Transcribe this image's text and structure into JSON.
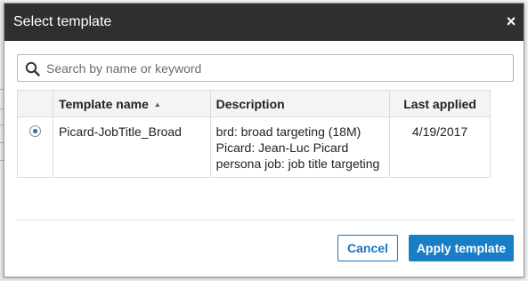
{
  "dialog": {
    "title": "Select template",
    "close_glyph": "×"
  },
  "search": {
    "placeholder": "Search by name or keyword",
    "value": ""
  },
  "table": {
    "columns": {
      "name": "Template name",
      "description": "Description",
      "last_applied": "Last applied"
    },
    "sort_indicator": "▲",
    "rows": [
      {
        "selected": true,
        "name": "Picard-JobTitle_Broad",
        "description": "brd: broad targeting (18M) Picard: Jean-Luc Picard persona job: job title targeting",
        "last_applied": "4/19/2017"
      }
    ]
  },
  "buttons": {
    "cancel": "Cancel",
    "apply": "Apply template"
  },
  "colors": {
    "header_bg": "#2f2f2f",
    "accent": "#1a74c4",
    "primary_button": "#1a7ec7"
  },
  "icons": {
    "search": "search-icon",
    "close": "close-icon",
    "sort": "sort-ascending-icon"
  }
}
